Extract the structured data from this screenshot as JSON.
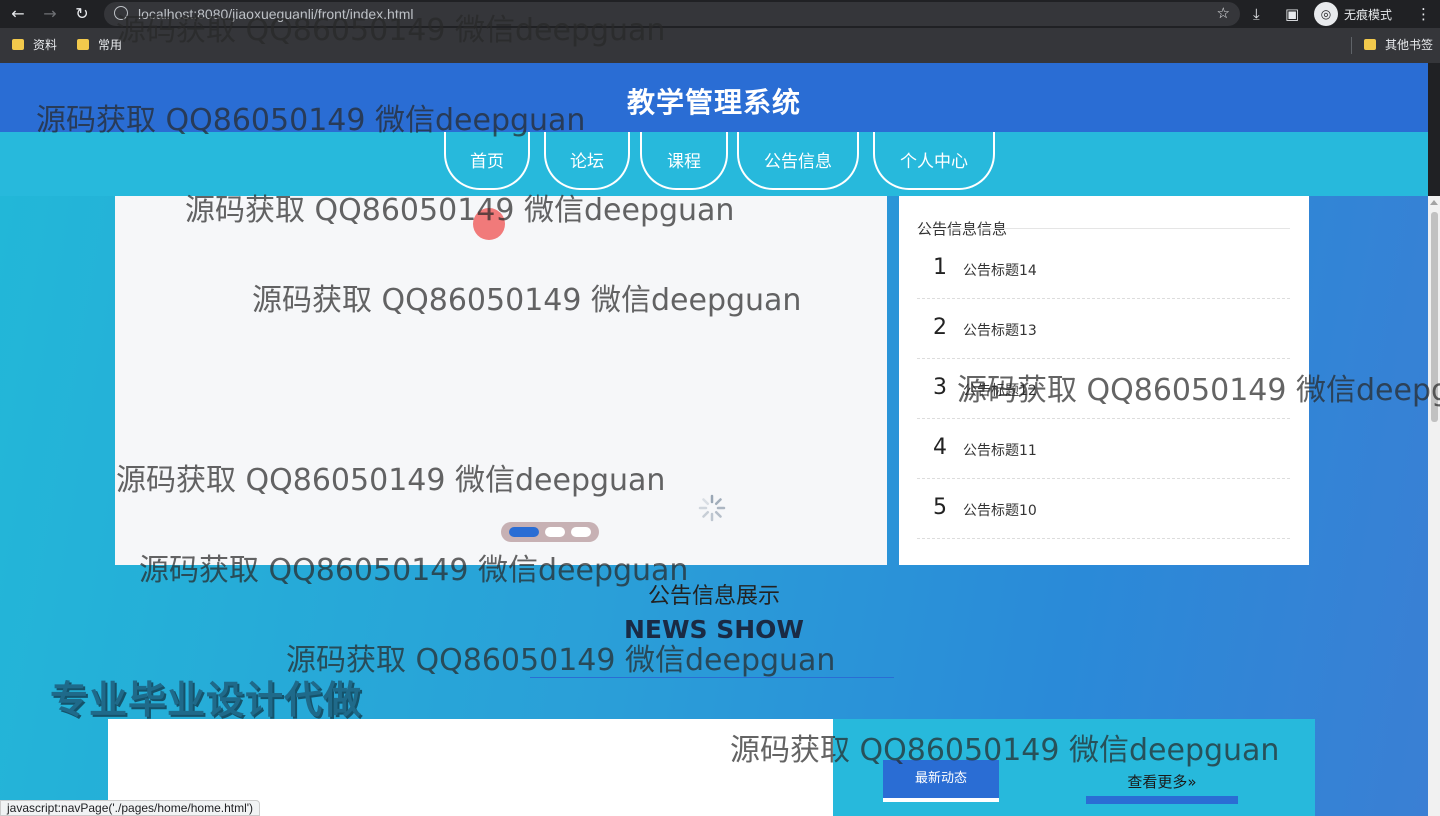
{
  "browser": {
    "url": "localhost:8080/jiaoxueguanli/front/index.html",
    "incognito_label": "无痕模式",
    "bookmarks": [
      "资料",
      "常用"
    ],
    "other_bookmarks": "其他书签",
    "status_url": "javascript:navPage('./pages/home/home.html')"
  },
  "site": {
    "title": "教学管理系统",
    "nav": [
      "首页",
      "论坛",
      "课程",
      "公告信息",
      "个人中心"
    ]
  },
  "notice": {
    "title": "公告信息信息",
    "items": [
      {
        "num": "1",
        "text": "公告标题14"
      },
      {
        "num": "2",
        "text": "公告标题13"
      },
      {
        "num": "3",
        "text": "公告标题12"
      },
      {
        "num": "4",
        "text": "公告标题11"
      },
      {
        "num": "5",
        "text": "公告标题10"
      }
    ]
  },
  "section": {
    "title_cn": "公告信息展示",
    "title_en": "NEWS SHOW"
  },
  "promo": "专业毕业设计代做",
  "news": {
    "tab_latest": "最新动态",
    "more": "查看更多»"
  },
  "watermark": "源码获取 QQ86050149 微信deepguan",
  "colors": {
    "header": "#2a6dd4",
    "nav": "#27b9dc",
    "accent": "#2a6dd4"
  }
}
